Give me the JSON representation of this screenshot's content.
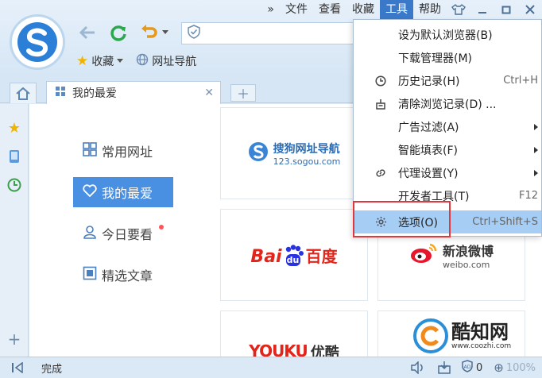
{
  "menubar": {
    "more": "»",
    "items": [
      "文件",
      "查看",
      "收藏",
      "工具",
      "帮助"
    ],
    "active_index": 3
  },
  "address": {
    "value": ""
  },
  "bookmarks": {
    "favorites": "收藏",
    "nav": "网址导航"
  },
  "tab": {
    "title": "我的最爱"
  },
  "left_nav": {
    "items": [
      "常用网址",
      "我的最爱",
      "今日要看",
      "精选文章"
    ],
    "active_index": 1
  },
  "tiles": {
    "sogou": {
      "name": "搜狗网址导航",
      "url": "123.sogou.com"
    },
    "baidu": {
      "name": "Bai",
      "du": "du",
      "cn": "百度"
    },
    "weibo": {
      "name": "新浪微博",
      "url": "weibo.com"
    },
    "youku": {
      "name": "YOUKU",
      "cn": "优酷"
    }
  },
  "tools_menu": {
    "items": [
      {
        "label": "设为默认浏览器(B)",
        "shortcut": "",
        "submenu": false,
        "icon": ""
      },
      {
        "label": "下载管理器(M)",
        "shortcut": "",
        "submenu": false,
        "icon": ""
      },
      {
        "label": "历史记录(H)",
        "shortcut": "Ctrl+H",
        "submenu": false,
        "icon": "clock-icon"
      },
      {
        "label": "清除浏览记录(D) ...",
        "shortcut": "",
        "submenu": false,
        "icon": "eraser-icon"
      },
      {
        "label": "广告过滤(A)",
        "shortcut": "",
        "submenu": true,
        "icon": ""
      },
      {
        "label": "智能填表(F)",
        "shortcut": "",
        "submenu": true,
        "icon": ""
      },
      {
        "label": "代理设置(Y)",
        "shortcut": "",
        "submenu": true,
        "icon": "link-icon"
      },
      {
        "label": "开发者工具(T)",
        "shortcut": "F12",
        "submenu": false,
        "icon": ""
      },
      {
        "label": "选项(O)",
        "shortcut": "Ctrl+Shift+S",
        "submenu": false,
        "icon": "gear-icon",
        "highlighted": true
      }
    ]
  },
  "statusbar": {
    "status": "完成",
    "adblock_count": "0",
    "zoom": "100%"
  },
  "watermark": {
    "name": "酷知网",
    "url": "www.coozhi.com"
  },
  "colors": {
    "accent": "#4a90e2",
    "highlight": "#a6cdf3",
    "red_box": "#e0383e"
  }
}
